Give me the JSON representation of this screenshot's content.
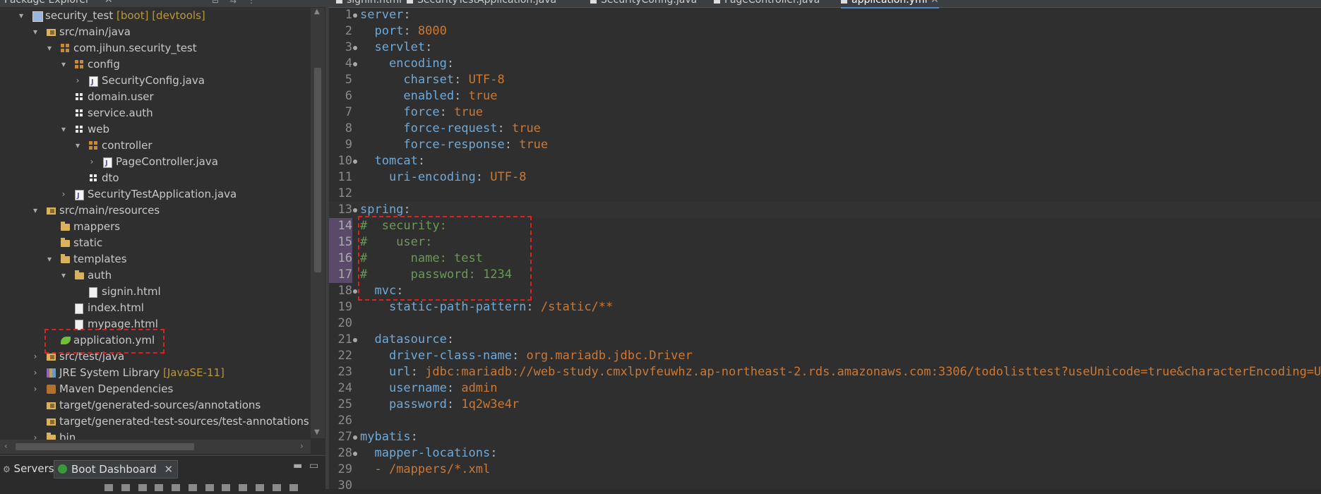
{
  "explorer": {
    "title": "Package Explorer",
    "tree": [
      {
        "label": "security_test",
        "decor": " [boot] [devtools]",
        "icon": "project-icon",
        "twisty": "▾",
        "depth": 0
      },
      {
        "label": "src/main/java",
        "icon": "source-folder-icon",
        "twisty": "▾",
        "depth": 1
      },
      {
        "label": "com.jihun.security_test",
        "icon": "package-icon",
        "twisty": "▾",
        "depth": 2
      },
      {
        "label": "config",
        "icon": "package-icon",
        "twisty": "▾",
        "depth": 3
      },
      {
        "label": "SecurityConfig.java",
        "icon": "java-file-icon",
        "twisty": "›",
        "depth": 4
      },
      {
        "label": "domain.user",
        "icon": "empty-package-icon",
        "twisty": "",
        "depth": 3
      },
      {
        "label": "service.auth",
        "icon": "empty-package-icon",
        "twisty": "",
        "depth": 3
      },
      {
        "label": "web",
        "icon": "empty-package-icon",
        "twisty": "▾",
        "depth": 3
      },
      {
        "label": "controller",
        "icon": "package-icon",
        "twisty": "▾",
        "depth": 4
      },
      {
        "label": "PageController.java",
        "icon": "java-file-icon",
        "twisty": "›",
        "depth": 5
      },
      {
        "label": "dto",
        "icon": "empty-package-icon",
        "twisty": "",
        "depth": 4
      },
      {
        "label": "SecurityTestApplication.java",
        "icon": "java-file-icon",
        "twisty": "›",
        "depth": 3
      },
      {
        "label": "src/main/resources",
        "icon": "source-folder-icon",
        "twisty": "▾",
        "depth": 1
      },
      {
        "label": "mappers",
        "icon": "folder-icon",
        "twisty": "",
        "depth": 2
      },
      {
        "label": "static",
        "icon": "folder-icon",
        "twisty": "",
        "depth": 2
      },
      {
        "label": "templates",
        "icon": "folder-icon",
        "twisty": "▾",
        "depth": 2
      },
      {
        "label": "auth",
        "icon": "folder-icon",
        "twisty": "▾",
        "depth": 3
      },
      {
        "label": "signin.html",
        "icon": "file-icon",
        "twisty": "",
        "depth": 4
      },
      {
        "label": "index.html",
        "icon": "file-icon",
        "twisty": "",
        "depth": 3
      },
      {
        "label": "mypage.html",
        "icon": "file-icon",
        "twisty": "",
        "depth": 3
      },
      {
        "label": "application.yml",
        "icon": "yaml-file-icon",
        "twisty": "",
        "depth": 2
      },
      {
        "label": "src/test/java",
        "icon": "source-folder-icon",
        "twisty": "›",
        "depth": 1
      },
      {
        "label": "JRE System Library",
        "decor": " [JavaSE-11]",
        "icon": "library-icon",
        "twisty": "›",
        "depth": 1
      },
      {
        "label": "Maven Dependencies",
        "icon": "maven-icon",
        "twisty": "›",
        "depth": 1
      },
      {
        "label": "target/generated-sources/annotations",
        "icon": "source-folder-icon",
        "twisty": "",
        "depth": 1
      },
      {
        "label": "target/generated-test-sources/test-annotations",
        "icon": "source-folder-icon",
        "twisty": "",
        "depth": 1
      },
      {
        "label": "bin",
        "icon": "folder-icon",
        "twisty": "›",
        "depth": 1
      }
    ]
  },
  "bottom_tabs": {
    "servers": "Servers",
    "boot_dashboard": "Boot Dashboard"
  },
  "editor": {
    "tabs": [
      {
        "label": "signin.html",
        "active": false
      },
      {
        "label": "SecurityTestApplication.java",
        "active": false
      },
      {
        "label": "SecurityConfig.java",
        "active": false
      },
      {
        "label": "PageController.java",
        "active": false
      },
      {
        "label": "application.yml",
        "active": true
      }
    ],
    "lines": [
      {
        "n": "1",
        "fold": true,
        "parts": [
          [
            "k",
            "server"
          ],
          [
            "p",
            ":"
          ]
        ]
      },
      {
        "n": "2",
        "fold": false,
        "parts": [
          [
            "p",
            "  "
          ],
          [
            "k",
            "port"
          ],
          [
            "p",
            ": "
          ],
          [
            "v",
            "8000"
          ]
        ]
      },
      {
        "n": "3",
        "fold": true,
        "parts": [
          [
            "p",
            "  "
          ],
          [
            "k",
            "servlet"
          ],
          [
            "p",
            ":"
          ]
        ]
      },
      {
        "n": "4",
        "fold": true,
        "parts": [
          [
            "p",
            "    "
          ],
          [
            "k",
            "encoding"
          ],
          [
            "p",
            ":"
          ]
        ]
      },
      {
        "n": "5",
        "fold": false,
        "parts": [
          [
            "p",
            "      "
          ],
          [
            "k",
            "charset"
          ],
          [
            "p",
            ": "
          ],
          [
            "v",
            "UTF-8"
          ]
        ]
      },
      {
        "n": "6",
        "fold": false,
        "parts": [
          [
            "p",
            "      "
          ],
          [
            "k",
            "enabled"
          ],
          [
            "p",
            ": "
          ],
          [
            "v",
            "true"
          ]
        ]
      },
      {
        "n": "7",
        "fold": false,
        "parts": [
          [
            "p",
            "      "
          ],
          [
            "k",
            "force"
          ],
          [
            "p",
            ": "
          ],
          [
            "v",
            "true"
          ]
        ]
      },
      {
        "n": "8",
        "fold": false,
        "parts": [
          [
            "p",
            "      "
          ],
          [
            "k",
            "force-request"
          ],
          [
            "p",
            ": "
          ],
          [
            "v",
            "true"
          ]
        ]
      },
      {
        "n": "9",
        "fold": false,
        "parts": [
          [
            "p",
            "      "
          ],
          [
            "k",
            "force-response"
          ],
          [
            "p",
            ": "
          ],
          [
            "v",
            "true"
          ]
        ]
      },
      {
        "n": "10",
        "fold": true,
        "parts": [
          [
            "p",
            "  "
          ],
          [
            "k",
            "tomcat"
          ],
          [
            "p",
            ":"
          ]
        ]
      },
      {
        "n": "11",
        "fold": false,
        "parts": [
          [
            "p",
            "    "
          ],
          [
            "k",
            "uri-encoding"
          ],
          [
            "p",
            ": "
          ],
          [
            "v",
            "UTF-8"
          ]
        ]
      },
      {
        "n": "12",
        "fold": false,
        "parts": []
      },
      {
        "n": "13",
        "fold": true,
        "cur": true,
        "parts": [
          [
            "k",
            "spring"
          ],
          [
            "p",
            ":"
          ]
        ]
      },
      {
        "n": "14",
        "fold": false,
        "hl": true,
        "parts": [
          [
            "c",
            "#  security:"
          ]
        ]
      },
      {
        "n": "15",
        "fold": false,
        "hl": true,
        "parts": [
          [
            "c",
            "#    user:"
          ]
        ]
      },
      {
        "n": "16",
        "fold": false,
        "hl": true,
        "parts": [
          [
            "c",
            "#      name: test"
          ]
        ]
      },
      {
        "n": "17",
        "fold": false,
        "hl": true,
        "parts": [
          [
            "c",
            "#      password: 1234"
          ]
        ]
      },
      {
        "n": "18",
        "fold": true,
        "parts": [
          [
            "p",
            "  "
          ],
          [
            "k",
            "mvc"
          ],
          [
            "p",
            ":"
          ]
        ]
      },
      {
        "n": "19",
        "fold": false,
        "parts": [
          [
            "p",
            "    "
          ],
          [
            "k",
            "static-path-pattern"
          ],
          [
            "p",
            ": "
          ],
          [
            "v",
            "/static/**"
          ]
        ]
      },
      {
        "n": "20",
        "fold": false,
        "parts": []
      },
      {
        "n": "21",
        "fold": true,
        "parts": [
          [
            "p",
            "  "
          ],
          [
            "k",
            "datasource"
          ],
          [
            "p",
            ":"
          ]
        ]
      },
      {
        "n": "22",
        "fold": false,
        "parts": [
          [
            "p",
            "    "
          ],
          [
            "k",
            "driver-class-name"
          ],
          [
            "p",
            ": "
          ],
          [
            "v",
            "org.mariadb.jdbc.Driver"
          ]
        ]
      },
      {
        "n": "23",
        "fold": false,
        "parts": [
          [
            "p",
            "    "
          ],
          [
            "k",
            "url"
          ],
          [
            "p",
            ": "
          ],
          [
            "v",
            "jdbc:mariadb://web-study.cmxlpvfeuwhz.ap-northeast-2.rds.amazonaws.com:3306/todolisttest?useUnicode=true&characterEncoding=UTF"
          ]
        ]
      },
      {
        "n": "24",
        "fold": false,
        "parts": [
          [
            "p",
            "    "
          ],
          [
            "k",
            "username"
          ],
          [
            "p",
            ": "
          ],
          [
            "v",
            "admin"
          ]
        ]
      },
      {
        "n": "25",
        "fold": false,
        "parts": [
          [
            "p",
            "    "
          ],
          [
            "k",
            "password"
          ],
          [
            "p",
            ": "
          ],
          [
            "v",
            "1q2w3e4r"
          ]
        ]
      },
      {
        "n": "26",
        "fold": false,
        "parts": []
      },
      {
        "n": "27",
        "fold": true,
        "parts": [
          [
            "k",
            "mybatis"
          ],
          [
            "p",
            ":"
          ]
        ]
      },
      {
        "n": "28",
        "fold": true,
        "parts": [
          [
            "p",
            "  "
          ],
          [
            "k",
            "mapper-locations"
          ],
          [
            "p",
            ":"
          ]
        ]
      },
      {
        "n": "29",
        "fold": false,
        "parts": [
          [
            "p",
            "  "
          ],
          [
            "v",
            "- /mappers/*.xml"
          ]
        ]
      },
      {
        "n": "30",
        "fold": false,
        "parts": []
      }
    ]
  }
}
